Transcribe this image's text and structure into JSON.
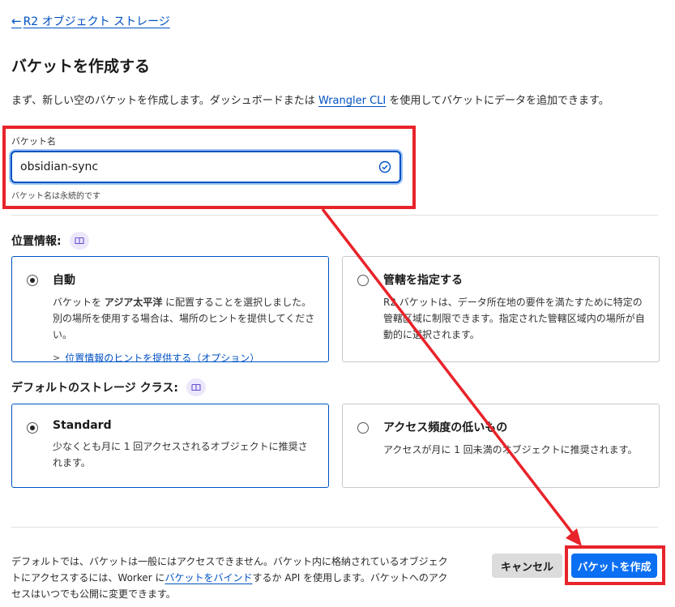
{
  "breadcrumb": {
    "arrow": "←",
    "label": "R2 オブジェクト ストレージ"
  },
  "page": {
    "title": "バケットを作成する",
    "intro_before": "まず、新しい空のバケットを作成します。ダッシュボードまたは ",
    "intro_link": "Wrangler CLI",
    "intro_after": " を使用してバケットにデータを追加できます。"
  },
  "bucket_name": {
    "label": "バケット名",
    "value": "obsidian-sync",
    "help": "バケット名は永続的です",
    "valid_icon": "check-circle-icon"
  },
  "location": {
    "label": "位置情報:",
    "info_icon": "book-icon",
    "options": [
      {
        "title": "自動",
        "selected": true,
        "desc_before": "バケットを ",
        "desc_bold": "アジア太平洋",
        "desc_after": " に配置することを選択しました。別の場所を使用する場合は、場所のヒントを提供してください。",
        "hint_link": "位置情報のヒントを提供する（オプション）"
      },
      {
        "title": "管轄を指定する",
        "selected": false,
        "desc": "R2 バケットは、データ所在地の要件を満たすために特定の管轄区域に制限できます。指定された管轄区域内の場所が自動的に選択されます。"
      }
    ]
  },
  "storage_class": {
    "label": "デフォルトのストレージ クラス:",
    "info_icon": "book-icon",
    "options": [
      {
        "title": "Standard",
        "selected": true,
        "desc": "少なくとも月に 1 回アクセスされるオブジェクトに推奨されます。"
      },
      {
        "title": "アクセス頻度の低いもの",
        "selected": false,
        "desc": "アクセスが月に 1 回未満のオブジェクトに推奨されます。"
      }
    ]
  },
  "footer": {
    "note_before": "デフォルトでは、バケットは一般にはアクセスできません。バケット内に格納されているオブジェクトにアクセスするには、Worker に",
    "note_link": "バケットをバインド",
    "note_after": "するか API を使用します。バケットへのアクセスはいつでも公開に変更できます。",
    "cancel_label": "キャンセル",
    "create_label": "バケットを作成"
  },
  "colors": {
    "accent": "#0051c3",
    "primary_button": "#0a6ff2",
    "annotation_red": "#e8232a"
  }
}
